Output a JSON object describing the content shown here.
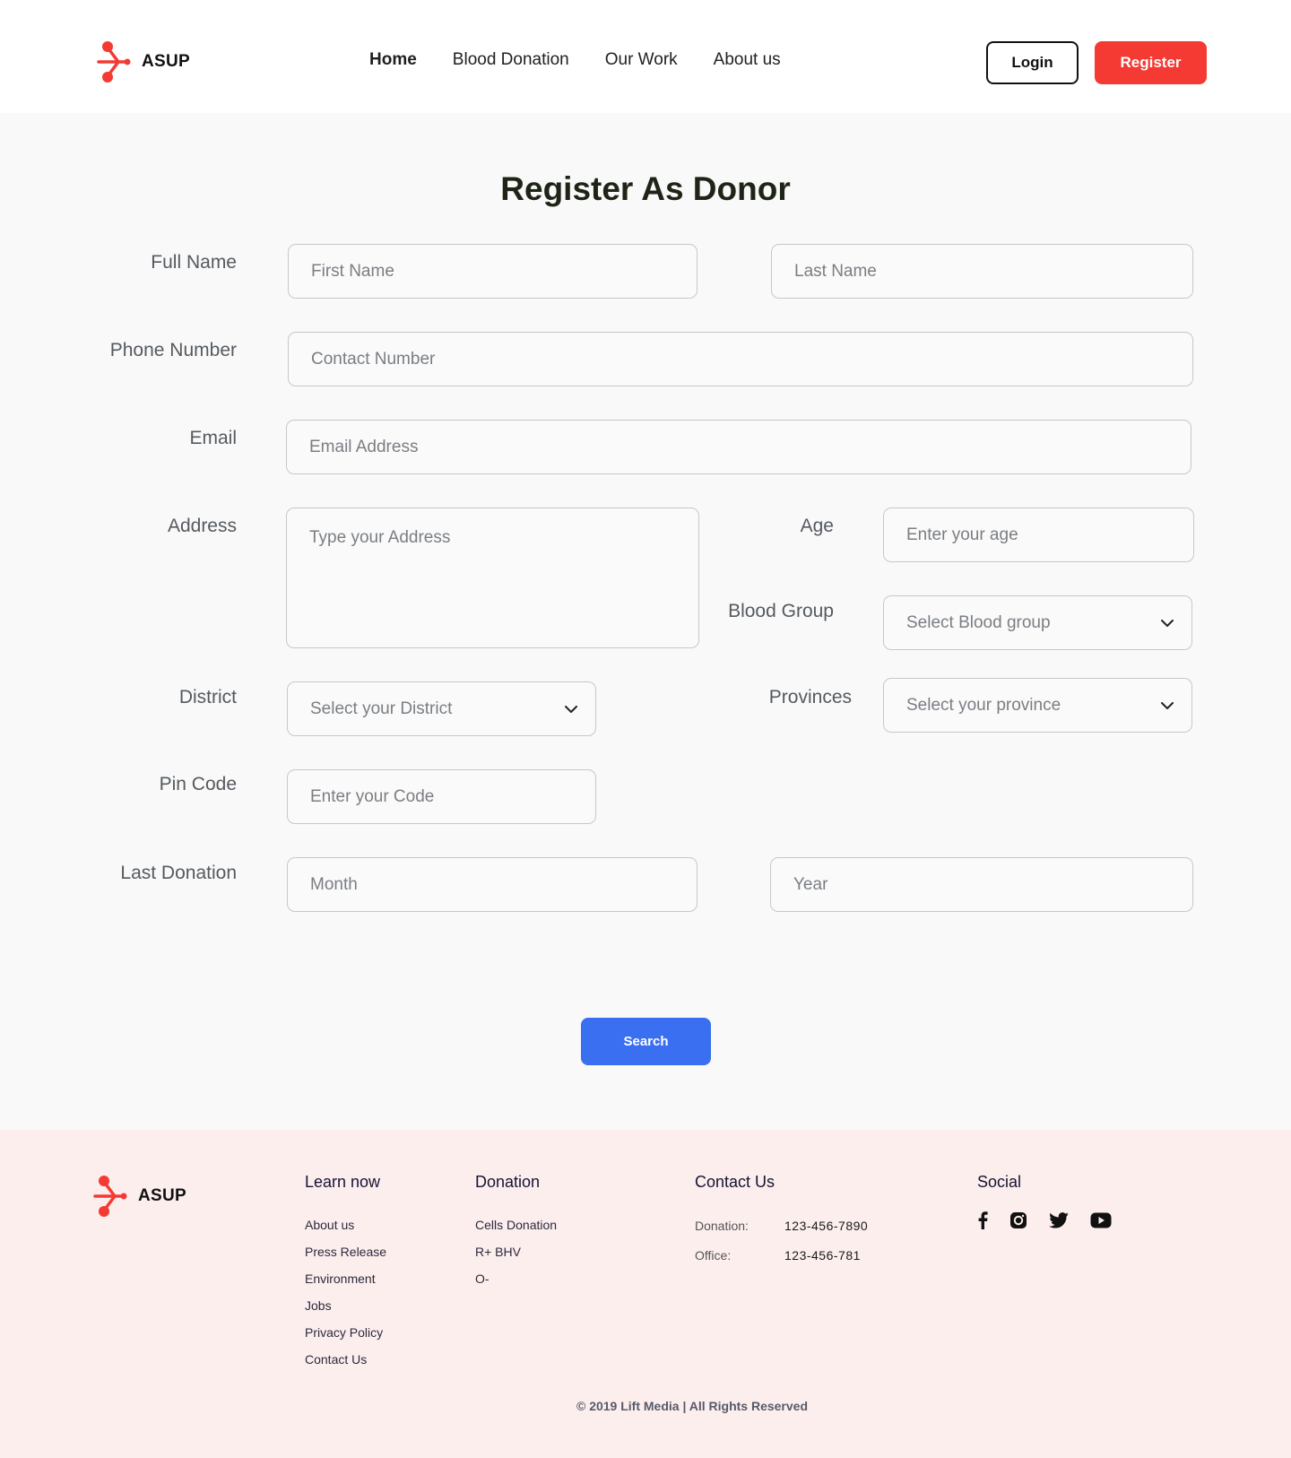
{
  "brand": {
    "name": "ASUP",
    "color": "#f43a32"
  },
  "nav": {
    "items": [
      {
        "label": "Home",
        "active": true
      },
      {
        "label": "Blood Donation",
        "active": false
      },
      {
        "label": "Our Work",
        "active": false
      },
      {
        "label": "About us",
        "active": false
      }
    ],
    "login_label": "Login",
    "register_label": "Register"
  },
  "form": {
    "title": "Register As Donor",
    "labels": {
      "full_name": "Full Name",
      "phone": "Phone Number",
      "email": "Email",
      "address": "Address",
      "age": "Age",
      "blood_group": "Blood Group",
      "district": "District",
      "provinces": "Provinces",
      "pin_code": "Pin Code",
      "last_donation": "Last Donation"
    },
    "placeholders": {
      "first_name": "First Name",
      "last_name": "Last Name",
      "contact": "Contact Number",
      "email": "Email Address",
      "address": "Type your Address",
      "age": "Enter your age",
      "blood_group": "Select Blood group",
      "district": "Select your District",
      "province": "Select your province",
      "pin_code": "Enter your Code",
      "month": "Month",
      "year": "Year"
    },
    "submit_label": "Search",
    "submit_color": "#3a6ff2"
  },
  "footer": {
    "brand": "ASUP",
    "learn": {
      "title": "Learn now",
      "links": [
        "About us",
        "Press Release",
        "Environment",
        "Jobs",
        "Privacy Policy",
        "Contact Us"
      ]
    },
    "donation": {
      "title": "Donation",
      "links": [
        "Cells Donation",
        "R+ BHV",
        "O-"
      ]
    },
    "contact": {
      "title": "Contact Us",
      "rows": [
        {
          "key": "Donation:",
          "value": "123-456-7890"
        },
        {
          "key": "Office:",
          "value": "123-456-781"
        }
      ]
    },
    "social": {
      "title": "Social",
      "icons": [
        "facebook-icon",
        "instagram-icon",
        "twitter-icon",
        "youtube-icon"
      ]
    },
    "copyright": "© 2019 Lift Media | All Rights Reserved",
    "background": "#fdeeee"
  }
}
